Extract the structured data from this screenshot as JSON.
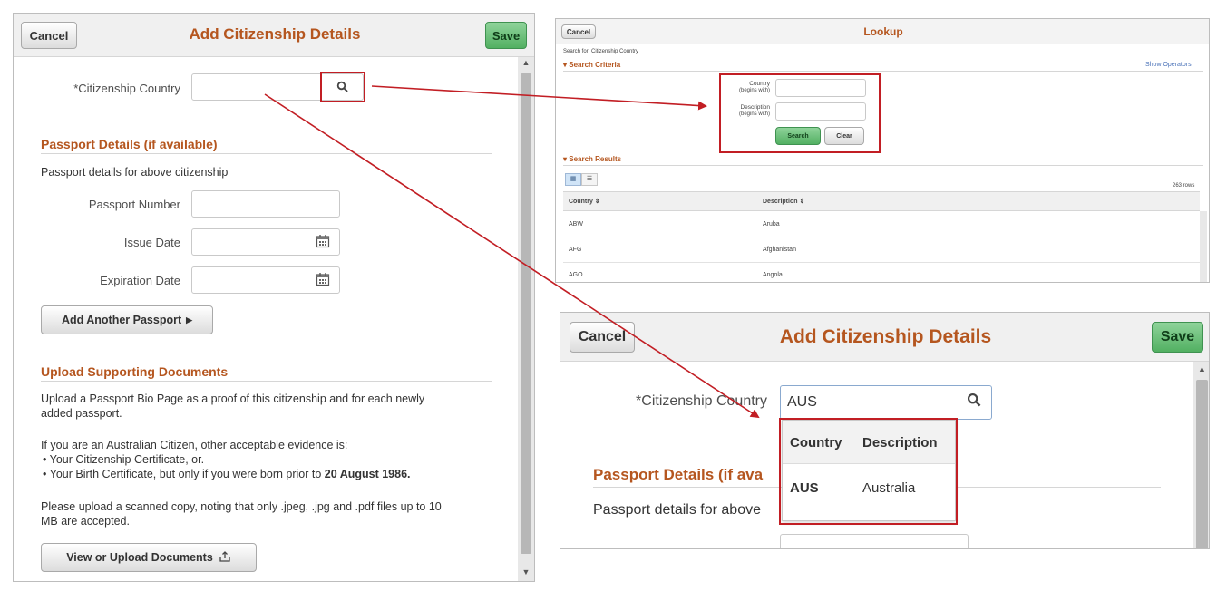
{
  "left_panel": {
    "cancel_label": "Cancel",
    "title": "Add Citizenship Details",
    "save_label": "Save",
    "citizenship_country_label": "*Citizenship Country",
    "passport_section_title": "Passport Details (if available)",
    "passport_intro": "Passport details for above citizenship",
    "passport_number_label": "Passport Number",
    "issue_date_label": "Issue Date",
    "expiration_date_label": "Expiration Date",
    "add_passport_label": "Add Another Passport",
    "upload_section_title": "Upload Supporting Documents",
    "upload_text_1a": "Upload a Passport Bio Page as a proof of this citizenship and for each newly",
    "upload_text_1b": "added passport.",
    "upload_text_2": "If you are an Australian Citizen, other acceptable evidence is:",
    "bullet_1": "Your Citizenship Certificate, or.",
    "bullet_2_prefix": "Your Birth Certificate, but only if you were born prior to ",
    "bullet_2_date": "20 August 1986.",
    "upload_text_3a": "Please upload a scanned copy, noting that only .jpeg, .jpg and .pdf files up to 10",
    "upload_text_3b": "MB are accepted.",
    "view_upload_label": "View or Upload Documents"
  },
  "lookup_panel": {
    "cancel_label": "Cancel",
    "title": "Lookup",
    "search_for": "Search for: Citizenship Country",
    "search_criteria_title": "Search Criteria",
    "show_operators": "Show Operators",
    "country_label_1": "Country",
    "country_label_2": "(begins with)",
    "description_label_1": "Description",
    "description_label_2": "(begins with)",
    "search_label": "Search",
    "clear_label": "Clear",
    "search_results_title": "Search Results",
    "rows_count": "263 rows",
    "col_country": "Country",
    "col_description": "Description",
    "rows": [
      {
        "country": "ABW",
        "description": "Aruba"
      },
      {
        "country": "AFG",
        "description": "Afghanistan"
      },
      {
        "country": "AGO",
        "description": "Angola"
      }
    ]
  },
  "zoom_panel": {
    "cancel_label": "Cancel",
    "title": "Add Citizenship Details",
    "save_label": "Save",
    "citizenship_country_label": "*Citizenship Country",
    "country_value": "AUS",
    "dropdown_header_country": "Country",
    "dropdown_header_description": "Description",
    "dropdown_country": "AUS",
    "dropdown_description": "Australia",
    "passport_section_title": "Passport Details (if ava",
    "passport_intro": "Passport details for above"
  },
  "colors": {
    "accent_orange": "#b5561f",
    "save_green": "#52b062",
    "highlight_red": "#c21e24"
  }
}
